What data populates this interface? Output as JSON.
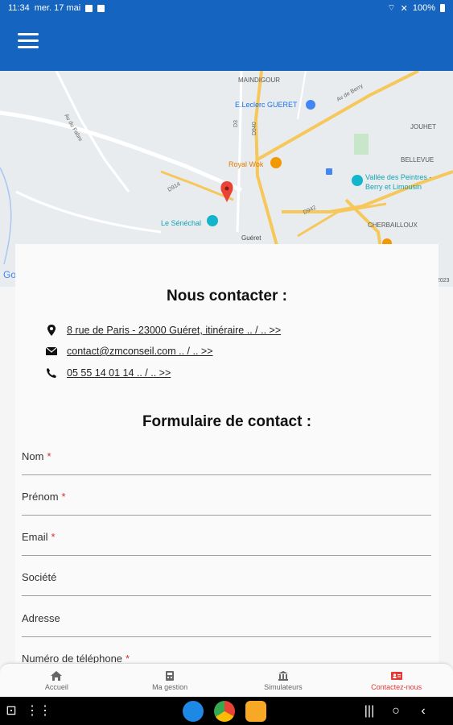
{
  "status_bar": {
    "time": "11:34",
    "date": "mer. 17 mai",
    "battery": "100%"
  },
  "map": {
    "labels": {
      "maindigour": "MAINDIGOUR",
      "leclerc": "E.Leclerc GUERET",
      "jouhet": "JOUHET",
      "bellevue": "BELLEVUE",
      "royal_wok": "Royal Wok",
      "vallee": "Vallée des Peintres -",
      "vallee2": "Berry et Limousin",
      "le_senechal": "Le Sénéchal",
      "gueret": "Guéret",
      "cherbailloux": "CHERBAILLOUX",
      "d914": "D914",
      "d942": "D942",
      "d940": "D940",
      "d3": "D3",
      "av_bery": "Av de Berry",
      "av_fabre": "Av du Fabre",
      "google": "Go",
      "year": "2023"
    }
  },
  "contact": {
    "title": "Nous contacter :",
    "address": "8 rue de Paris - 23000 Guéret, itinéraire .. / .. >>",
    "email": "contact@zmconseil.com .. / .. >>",
    "phone": "05 55 14 01 14 .. / .. >>"
  },
  "form": {
    "title": "Formulaire de contact :",
    "fields": [
      {
        "label": "Nom",
        "required": "*"
      },
      {
        "label": "Prénom",
        "required": "*"
      },
      {
        "label": "Email",
        "required": "*"
      },
      {
        "label": "Société",
        "required": ""
      },
      {
        "label": "Adresse",
        "required": ""
      },
      {
        "label": "Numéro de téléphone",
        "required": "*"
      }
    ]
  },
  "bottom_nav": [
    {
      "label": "Accueil"
    },
    {
      "label": "Ma gestion"
    },
    {
      "label": "Simulateurs"
    },
    {
      "label": "Contactez-nous"
    }
  ],
  "colors": {
    "primary": "#1565c0",
    "accent": "#e53935"
  }
}
